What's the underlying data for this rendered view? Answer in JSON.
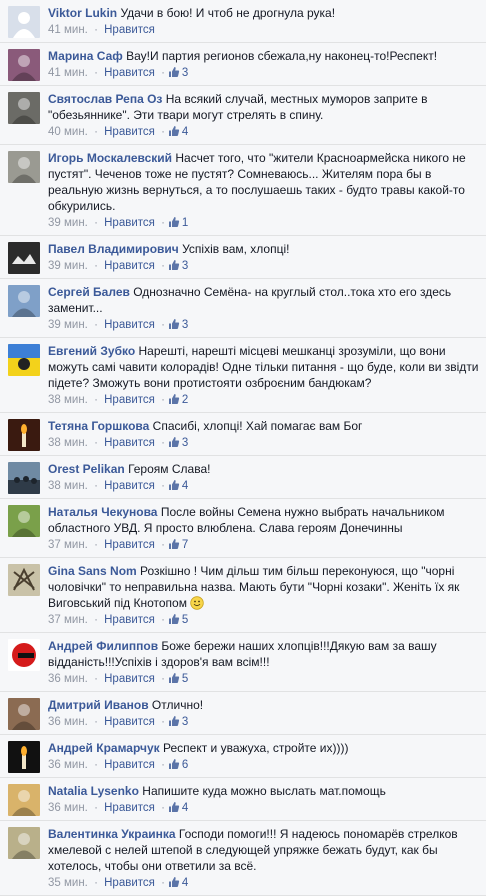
{
  "labels": {
    "like": "Нравится",
    "separator": "·"
  },
  "comments": [
    {
      "author": "Viktor Lukin",
      "text": "Удачи в бою! И чтоб не дрогнула рука!",
      "time": "41 мин.",
      "likes": "",
      "avatar_icon": "avatar-plain-icon",
      "avatar_color": "#d8dfea"
    },
    {
      "author": "Марина Саф",
      "text": "Вау!И партия регионов сбежала,ну наконец-то!Респект!",
      "time": "41 мин.",
      "likes": "3",
      "avatar_icon": "avatar-photo-icon",
      "avatar_color": "#8a5a7a"
    },
    {
      "author": "Святослав Репа Оз",
      "text": "На всякий случай, местных муморов заприте в \"обезьяннике\". Эти твари могут стрелять в спину.",
      "time": "40 мин.",
      "likes": "4",
      "avatar_icon": "avatar-photo-icon",
      "avatar_color": "#6b6b66"
    },
    {
      "author": "Игорь Москалевский",
      "text": "Насчет того, что \"жители Красноармейска никого не пустят\". Чеченов тоже не пустят? Сомневаюсь... Жителям пора бы в реальную жизнь вернуться, а то послушаешь таких - будто травы какой-то обкурились.",
      "time": "39 мин.",
      "likes": "1",
      "avatar_icon": "avatar-photo-icon",
      "avatar_color": "#9a9a92"
    },
    {
      "author": "Павел Владимирович",
      "text": "Успіхів вам, хлопці!",
      "time": "39 мин.",
      "likes": "3",
      "avatar_icon": "avatar-dark-icon",
      "avatar_color": "#2b2b2b"
    },
    {
      "author": "Сергей Балев",
      "text": "Однозначно Семёна- на круглый стол..тока хто его здесь заменит...",
      "time": "39 мин.",
      "likes": "3",
      "avatar_icon": "avatar-photo-icon",
      "avatar_color": "#7fa0c8"
    },
    {
      "author": "Евгений Зубко",
      "text": "Нарешті, нарешті місцеві мешканці зрозуміли, що вони можуть самі чавити колорадів! Одне тільки питання - що буде, коли ви звідти підете? Зможуть вони протистояти озброєним бандюкам?",
      "time": "38 мин.",
      "likes": "2",
      "avatar_icon": "avatar-flag-icon",
      "avatar_color": "#f3d21b"
    },
    {
      "author": "Тетяна Горшкова",
      "text": "Спасибі, хлопці! Хай помагає вам Бог",
      "time": "38 мин.",
      "likes": "3",
      "avatar_icon": "avatar-candle-icon",
      "avatar_color": "#3a1a10"
    },
    {
      "author": "Orest Pelikan",
      "text": "Героям Слава!",
      "time": "38 мин.",
      "likes": "4",
      "avatar_icon": "avatar-crowd-icon",
      "avatar_color": "#6f8aa3"
    },
    {
      "author": "Наталья Чекунова",
      "text": "После войны Семена нужно выбрать начальником областного УВД. Я просто влюблена. Слава героям Донечинны",
      "time": "37 мин.",
      "likes": "7",
      "avatar_icon": "avatar-photo-icon",
      "avatar_color": "#7aa04a"
    },
    {
      "author": "Gina Sans Nom",
      "text": "Розкішно ! Чим дільш тим більш переконуюся, що \"чорні чоловічки\" то неправильна назва. Мають бути \"Чорні козаки\". Женіть їх як Виговський під Кнотопом",
      "time": "37 мин.",
      "likes": "5",
      "avatar_icon": "avatar-emblem-icon",
      "avatar_color": "#c9c2a8",
      "has_smile": true
    },
    {
      "author": "Андрей Филиппов",
      "text": "Боже бережи наших хлопців!!!Дякую вам за вашу відданість!!!Успіхів і здоров'я вам всім!!!",
      "time": "36 мин.",
      "likes": "5",
      "avatar_icon": "avatar-badge-icon",
      "avatar_color": "#ffffff"
    },
    {
      "author": "Дмитрий Иванов",
      "text": "Отлично!",
      "time": "36 мин.",
      "likes": "3",
      "avatar_icon": "avatar-photo-icon",
      "avatar_color": "#8b6b52"
    },
    {
      "author": "Андрей Крамарчук",
      "text": "Респект и уважуха, стройте их))))",
      "time": "36 мин.",
      "likes": "6",
      "avatar_icon": "avatar-candle-icon",
      "avatar_color": "#111111"
    },
    {
      "author": "Natalia Lysenko",
      "text": "Напишите куда можно выслать мат.помощь",
      "time": "36 мин.",
      "likes": "4",
      "avatar_icon": "avatar-photo-icon",
      "avatar_color": "#d9b36a"
    },
    {
      "author": "Валентинка Украинка",
      "text": "Господи помоги!!! Я надеюсь пономарёв стрелков хмелевой с нелей штепой в следующей упряжке бежать будут, как бы хотелось, чтобы они ответили за всё.",
      "time": "35 мин.",
      "likes": "4",
      "avatar_icon": "avatar-photo-icon",
      "avatar_color": "#b9b08a"
    }
  ]
}
